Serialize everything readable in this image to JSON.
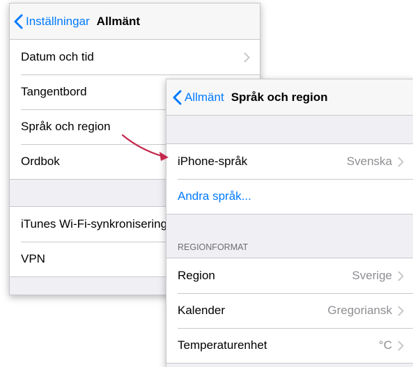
{
  "screen1": {
    "back_label": "Inställningar",
    "title": "Allmänt",
    "group1": [
      "Datum och tid",
      "Tangentbord",
      "Språk och region",
      "Ordbok"
    ],
    "group2": [
      "iTunes Wi-Fi-synkronisering",
      "VPN"
    ]
  },
  "screen2": {
    "back_label": "Allmänt",
    "title": "Språk och region",
    "iphone_language": {
      "label": "iPhone-språk",
      "value": "Svenska"
    },
    "other_languages": "Andra språk...",
    "region_header": "REGIONFORMAT",
    "region": {
      "label": "Region",
      "value": "Sverige"
    },
    "calendar": {
      "label": "Kalender",
      "value": "Gregoriansk"
    },
    "temperature": {
      "label": "Temperaturenhet",
      "value": "°C"
    }
  },
  "colors": {
    "accent": "#007aff",
    "arrow": "#c4284b"
  },
  "icons": {
    "back": "chevron-left-icon",
    "disclosure": "chevron-right-icon"
  }
}
